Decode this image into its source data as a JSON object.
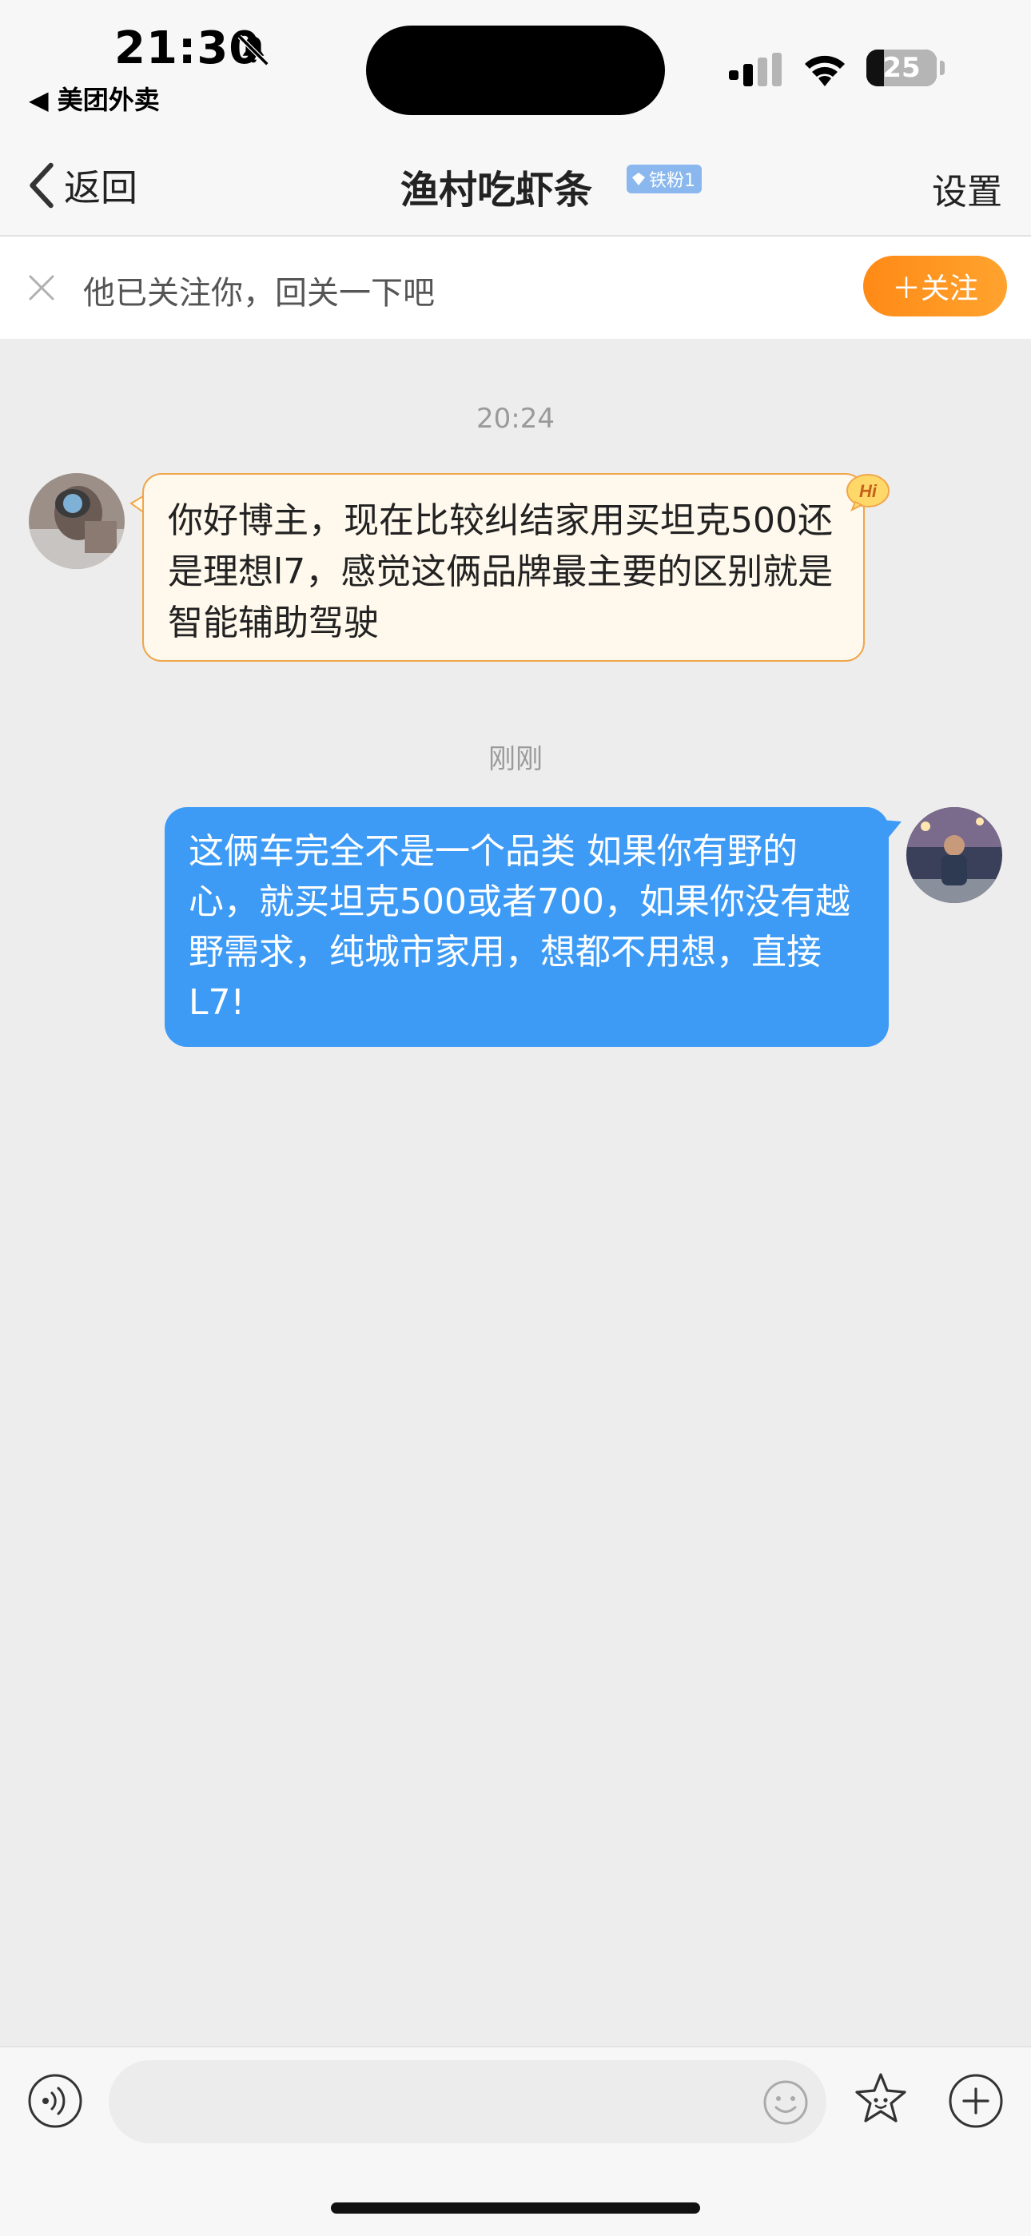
{
  "status_bar": {
    "time": "21:30",
    "back_app_label": "◀ 美团外卖",
    "battery_level": "25"
  },
  "nav": {
    "back_label": "返回",
    "title": "渔村吃虾条",
    "fan_badge": "铁粉1",
    "settings_label": "设置"
  },
  "follow_prompt": {
    "text": "他已关注你，回关一下吧",
    "button_label": "＋关注",
    "button_color": "#ff9120"
  },
  "messages": [
    {
      "timestamp": "20:24",
      "from": "other",
      "badge": "Hi",
      "text": "你好博主，现在比较纠结家用买坦克500还是理想l7，感觉这俩品牌最主要的区别就是智能辅助驾驶"
    },
    {
      "timestamp": "刚刚",
      "from": "self",
      "text": "这俩车完全不是一个品类 如果你有野的心，就买坦克500或者700，如果你没有越野需求，纯城市家用，想都不用想，直接L7!"
    }
  ],
  "input": {
    "placeholder": ""
  },
  "colors": {
    "outgoing_bubble": "#3d9bf6",
    "incoming_bubble": "#fff8ec",
    "incoming_border": "#f0a64a",
    "accent_orange": "#ff9120"
  },
  "icons": [
    "bell-slash-icon",
    "signal-icon",
    "wifi-icon",
    "battery-icon",
    "chevron-left-icon",
    "diamond-icon",
    "close-icon",
    "hi-badge-icon",
    "voice-icon",
    "emoji-icon",
    "star-face-icon",
    "plus-circle-icon"
  ]
}
